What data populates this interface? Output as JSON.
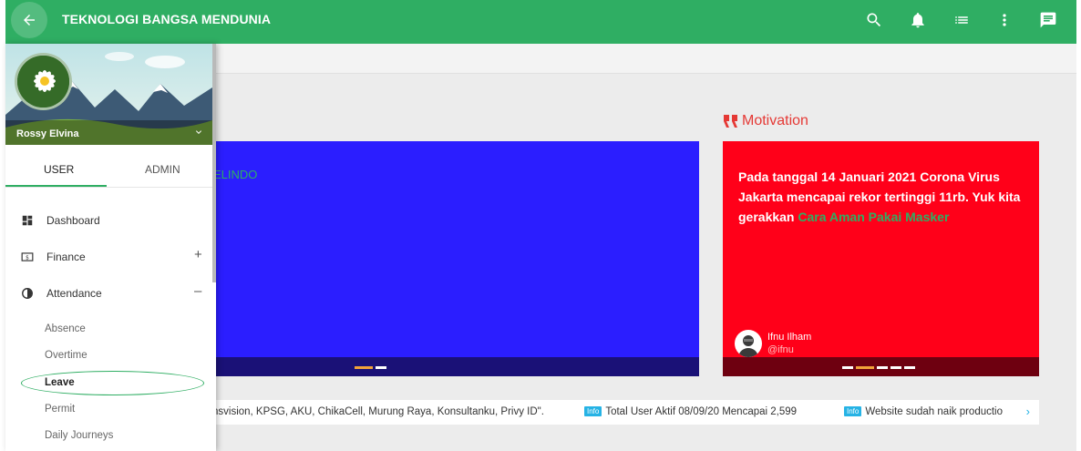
{
  "header": {
    "title": "TEKNOLOGI BANGSA MENDUNIA",
    "icons": [
      "back-arrow-icon",
      "search-icon",
      "bell-icon",
      "list-icon",
      "more-vert-icon",
      "chat-icon"
    ]
  },
  "sidebar": {
    "profile_name": "Rossy Elvina",
    "tabs": [
      {
        "label": "USER",
        "active": true
      },
      {
        "label": "ADMIN",
        "active": false
      }
    ],
    "items": [
      {
        "label": "Dashboard",
        "icon": "dashboard-icon",
        "toggle": ""
      },
      {
        "label": "Finance",
        "icon": "finance-icon",
        "toggle": "+"
      },
      {
        "label": "Attendance",
        "icon": "attendance-icon",
        "toggle": "–"
      }
    ],
    "subitems": [
      {
        "label": "Absence",
        "active": false
      },
      {
        "label": "Overtime",
        "active": false
      },
      {
        "label": "Leave",
        "active": true
      },
      {
        "label": "Permit",
        "active": false
      },
      {
        "label": "Daily Journeys",
        "active": false
      }
    ]
  },
  "banner": {
    "partial_text": "ELINDO"
  },
  "motivation": {
    "title": "Motivation",
    "quote_before": "Pada tanggal 14 Januari 2021 Corona Virus Jakarta mencapai rekor tertinggi 11rb. Yuk kita gerakkan ",
    "quote_highlight": "Cara Aman Pakai Masker",
    "author_name": "Ifnu Ilham",
    "author_handle": "@ifnu"
  },
  "ticker": {
    "partners": "nsvision, KPSG, AKU, ChikaCell, Murung Raya, Konsultanku, Privy ID\".",
    "items": [
      {
        "badge": "Info",
        "text": "Total User Aktif 08/09/20 Mencapai 2,599"
      },
      {
        "badge": "Info",
        "text": "Website sudah naik productio"
      }
    ],
    "arrow": "›"
  },
  "colors": {
    "primary": "#2fae63",
    "banner_blue": "#2b1eff",
    "motivation_red": "#ff0019",
    "info_badge": "#26b3e5"
  }
}
